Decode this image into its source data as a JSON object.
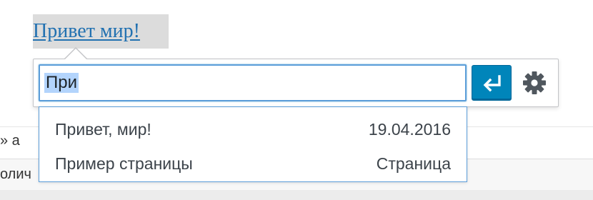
{
  "editor": {
    "link_text": "Привет мир!",
    "background_line_1": "» а",
    "background_line_2": "олич"
  },
  "link_popup": {
    "url_input_value": "При",
    "apply_button_label": "Apply",
    "settings_button_label": "Link options",
    "icons": {
      "apply": "return-arrow-icon",
      "settings": "gear-icon"
    },
    "colors": {
      "accent": "#0085ba",
      "focus_border": "#5b9dd9",
      "selection": "#b3d4fc",
      "link": "#2271b1"
    }
  },
  "autocomplete": {
    "items": [
      {
        "title": "Привет, мир!",
        "info": "19.04.2016"
      },
      {
        "title": "Пример страницы",
        "info": "Страница"
      }
    ]
  }
}
